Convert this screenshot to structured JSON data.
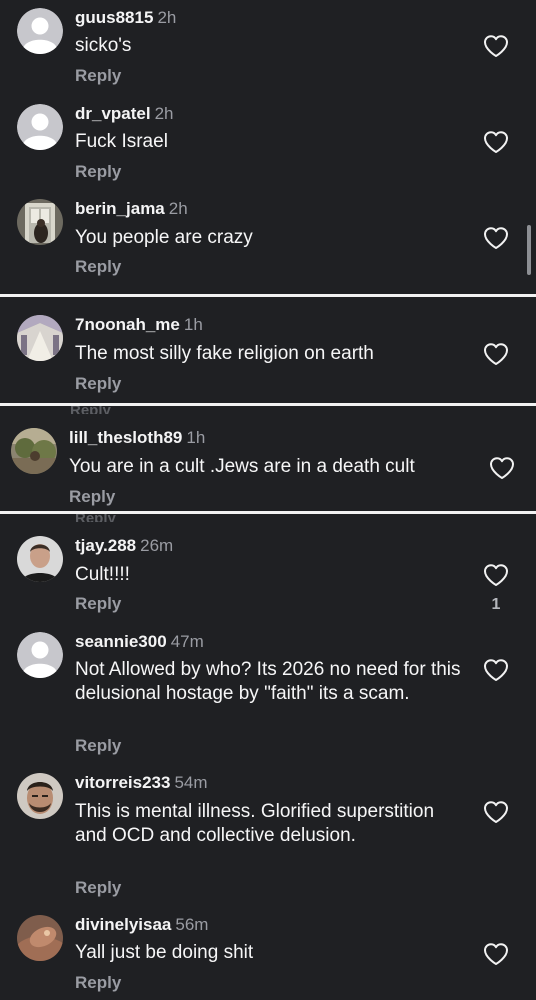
{
  "comments": [
    {
      "username": "guus8815",
      "time": "2h",
      "text": "sicko's",
      "reply": "Reply",
      "avatar": "default-avatar"
    },
    {
      "username": "dr_vpatel",
      "time": "2h",
      "text": "Fuck Israel",
      "reply": "Reply",
      "avatar": "default-avatar"
    },
    {
      "username": "berin_jama",
      "time": "2h",
      "text": "You people are crazy",
      "reply": "Reply",
      "avatar": "photo-avatar-doorway"
    },
    {
      "username": "7noonah_me",
      "time": "1h",
      "text": "The most silly fake religion on earth",
      "reply": "Reply",
      "avatar": "photo-avatar-room"
    },
    {
      "username": "lill_thesloth89",
      "time": "1h",
      "text": "You are in a cult .Jews are in a death cult",
      "reply": "Reply",
      "avatar": "photo-avatar-outdoor"
    },
    {
      "username": "tjay.288",
      "time": "26m",
      "text": "Cult!!!!",
      "reply": "Reply",
      "like_count": "1",
      "avatar": "photo-avatar-person"
    },
    {
      "username": "seannie300",
      "time": "47m",
      "text": "Not Allowed by who? Its 2026 no need for this delusional hostage by \"faith\" its a scam.",
      "reply": "Reply",
      "avatar": "default-avatar"
    },
    {
      "username": "vitorreis233",
      "time": "54m",
      "text": "This is mental illness. Glorified superstition and OCD and collective delusion.",
      "reply": "Reply",
      "avatar": "photo-avatar-face"
    },
    {
      "username": "divinelyisaa",
      "time": "56m",
      "text": "Yall just be doing shit",
      "reply": "Reply",
      "avatar": "photo-avatar-hand"
    }
  ],
  "ghost_reply": "Reply",
  "icons": {
    "like": "heart-outline-icon"
  },
  "colors": {
    "background": "#1f2023",
    "text": "#f4f4f5",
    "muted": "#9a9ca3",
    "divider": "#f2f2f2"
  }
}
